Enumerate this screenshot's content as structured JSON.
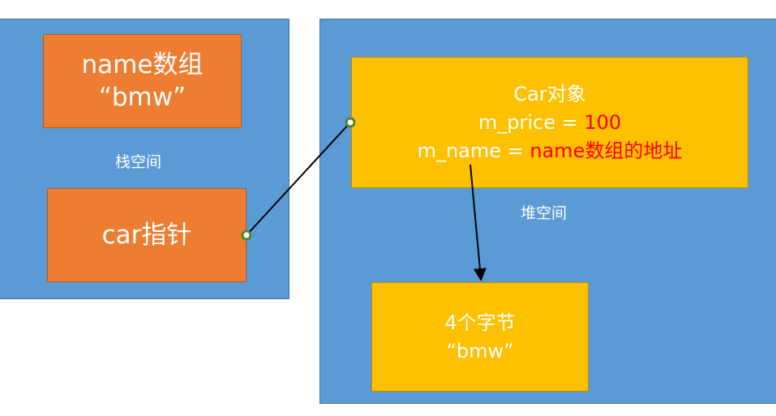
{
  "stack": {
    "label": "栈空间",
    "name_box": {
      "line1": "name数组",
      "line2": "“bmw”"
    },
    "pointer_box": {
      "text": "car指针"
    }
  },
  "heap": {
    "label": "堆空间",
    "car_object": {
      "title": "Car对象",
      "price_label": "m_price = ",
      "price_value": "100",
      "name_label": "m_name = ",
      "name_value": "name数组的地址"
    },
    "bytes_box": {
      "line1": "4个字节",
      "line2": "“bmw”"
    }
  },
  "colors": {
    "region": "#5b9bd5",
    "stack_box": "#ed7d31",
    "heap_box": "#ffc000",
    "highlight": "#ff0000",
    "connector_dot": "#548235"
  }
}
